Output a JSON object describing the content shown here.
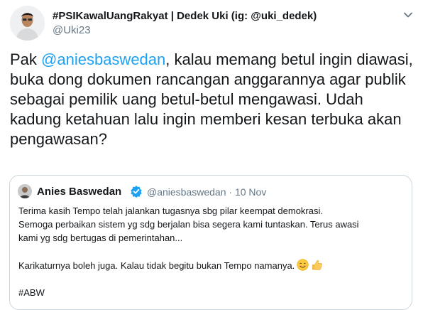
{
  "tweet": {
    "author_name": "#PSIKawalUangRakyat | Dedek Uki (ig: @uki_dedek)",
    "author_handle": "@Uki23",
    "text_prefix": "Pak ",
    "mention": "@aniesbaswedan",
    "text_suffix": ", kalau memang betul ingin diawasi, buka dong dokumen rancangan anggarannya agar publik sebagai pemilik uang betul-betul mengawasi. Udah kadung ketahuan lalu ingin memberi kesan terbuka akan pengawasan?"
  },
  "quoted_tweet": {
    "author_name": "Anies Baswedan",
    "author_handle": "@aniesbaswedan",
    "separator": "·",
    "date": "10 Nov",
    "lines": [
      "Terima kasih Tempo telah jalankan tugasnya sbg pilar keempat demokrasi.",
      "Semoga perbaikan sistem yg sdg berjalan bisa segera kami tuntaskan. Terus awasi",
      "kami yg sdg bertugas di pemerintahan...",
      "Karikaturnya boleh juga. Kalau tidak begitu bukan Tempo namanya.",
      "#ABW"
    ]
  },
  "icons": {
    "caret": "chevron-down-icon",
    "verified": "verified-badge-icon",
    "smile": "smiling-face-emoji-icon",
    "thumbs": "thumbs-up-emoji-icon"
  },
  "colors": {
    "link": "#1da1f2",
    "secondary_text": "#657786",
    "border": "#ccd6dd"
  }
}
